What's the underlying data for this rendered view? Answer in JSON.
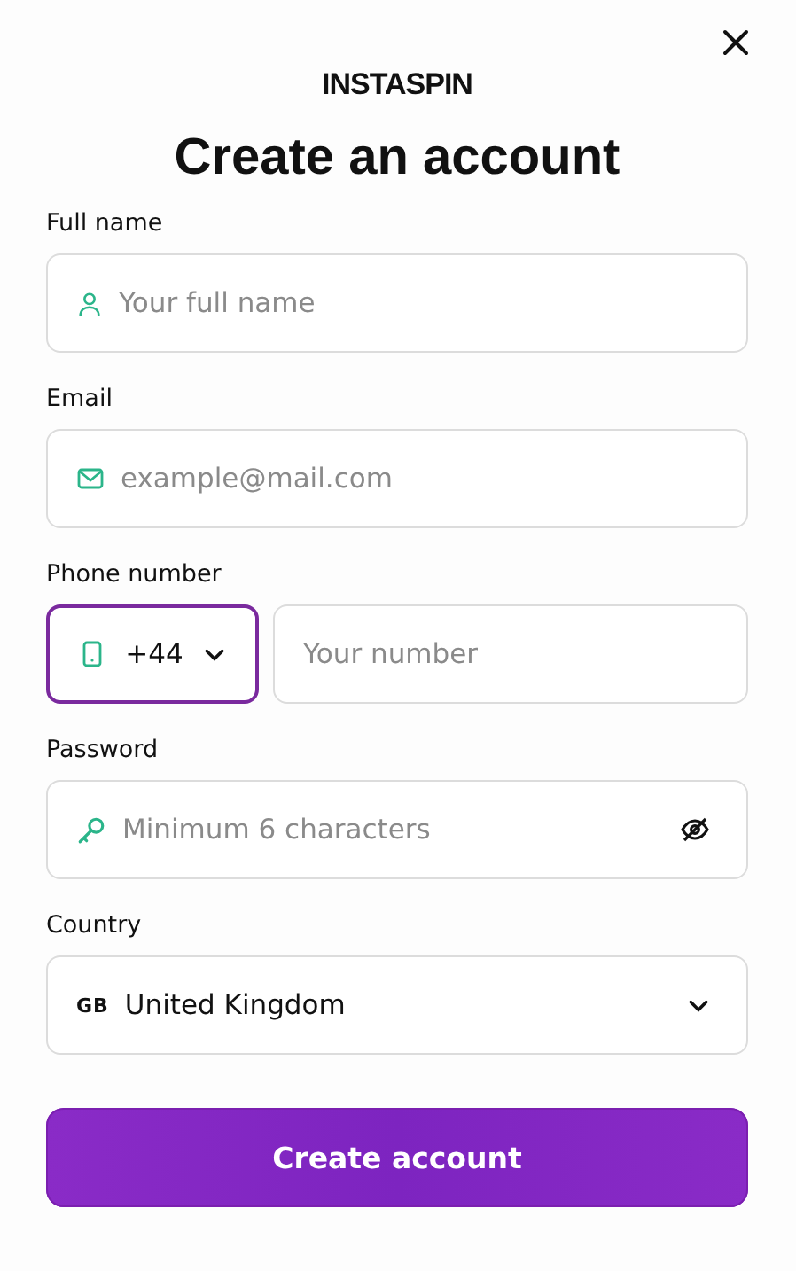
{
  "logo": "INSTASPIN",
  "title": "Create an account",
  "fields": [
    {
      "kind": "name",
      "label": "Full name",
      "placeholder": "Your full name"
    },
    {
      "kind": "email",
      "label": "Email",
      "placeholder": "example@mail.com"
    },
    {
      "kind": "phone",
      "label": "Phone number",
      "code": "+44",
      "focused": true,
      "placeholder": "Your number"
    },
    {
      "kind": "password",
      "label": "Password",
      "placeholder": "Minimum 6 characters"
    },
    {
      "kind": "country",
      "label": "Country",
      "flag": "GB",
      "value": "United Kingdom"
    }
  ],
  "submit": "Create account"
}
